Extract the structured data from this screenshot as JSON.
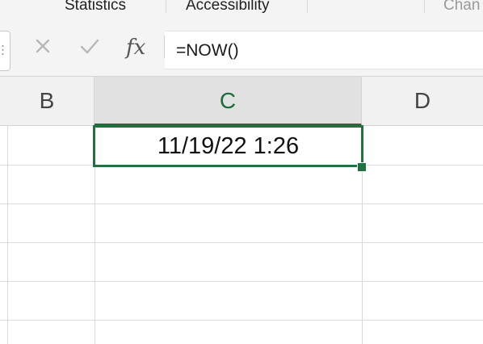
{
  "ribbon": {
    "tabs": [
      {
        "label": "Statistics"
      },
      {
        "label": "Accessibility"
      },
      {
        "label": "Chan"
      }
    ]
  },
  "formula_bar": {
    "formula": "=NOW()",
    "cancel_icon": "x-icon",
    "enter_icon": "checkmark-icon",
    "function_icon": "fx"
  },
  "columns": [
    {
      "label": "B",
      "active": false
    },
    {
      "label": "C",
      "active": true
    },
    {
      "label": "D",
      "active": false
    }
  ],
  "active_cell": {
    "column": "C",
    "value": "11/19/22 1:26"
  },
  "colors": {
    "accent": "#21703f",
    "header_bg": "#f1f1f1",
    "gridline": "#d9d9d9"
  }
}
